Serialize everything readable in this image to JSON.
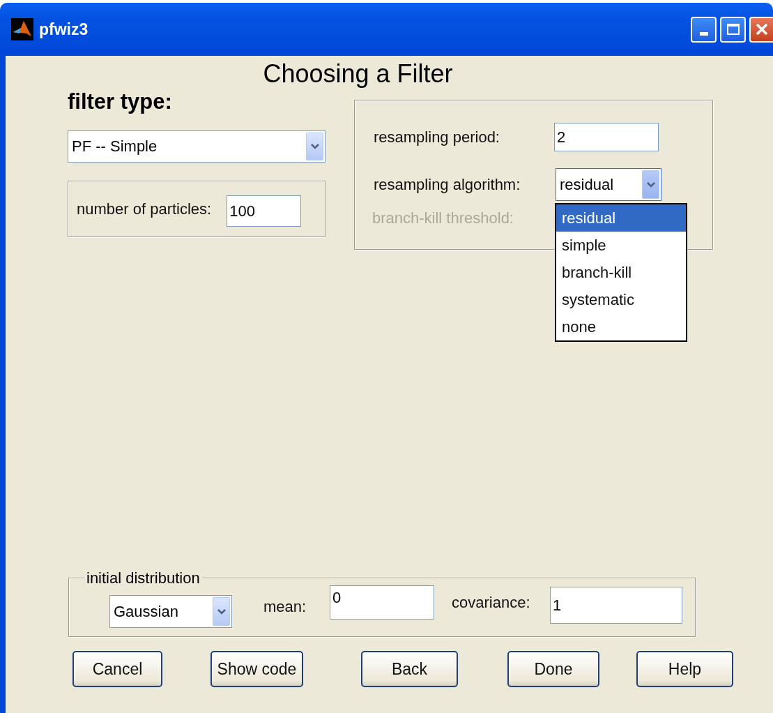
{
  "window": {
    "title": "pfwiz3"
  },
  "heading": "Choosing a Filter",
  "filter_type": {
    "label": "filter type:",
    "value": "PF -- Simple"
  },
  "particles": {
    "label": "number of particles:",
    "value": "100"
  },
  "resampling": {
    "period_label": "resampling period:",
    "period": "2",
    "algorithm_label": "resampling algorithm:",
    "algorithm": "residual",
    "expanded": true,
    "options": [
      {
        "label": "residual",
        "selected": true
      },
      {
        "label": "simple",
        "selected": false
      },
      {
        "label": "branch-kill",
        "selected": false
      },
      {
        "label": "systematic",
        "selected": false
      },
      {
        "label": "none",
        "selected": false
      }
    ],
    "threshold_label": "branch-kill threshold:",
    "threshold_disabled": true
  },
  "initial_distribution": {
    "legend": "initial distribution",
    "type": "Gaussian",
    "mean_label": "mean:",
    "mean": "0",
    "covariance_label": "covariance:",
    "covariance": "1"
  },
  "buttons": [
    "Cancel",
    "Show code",
    "Back",
    "Done",
    "Help"
  ]
}
